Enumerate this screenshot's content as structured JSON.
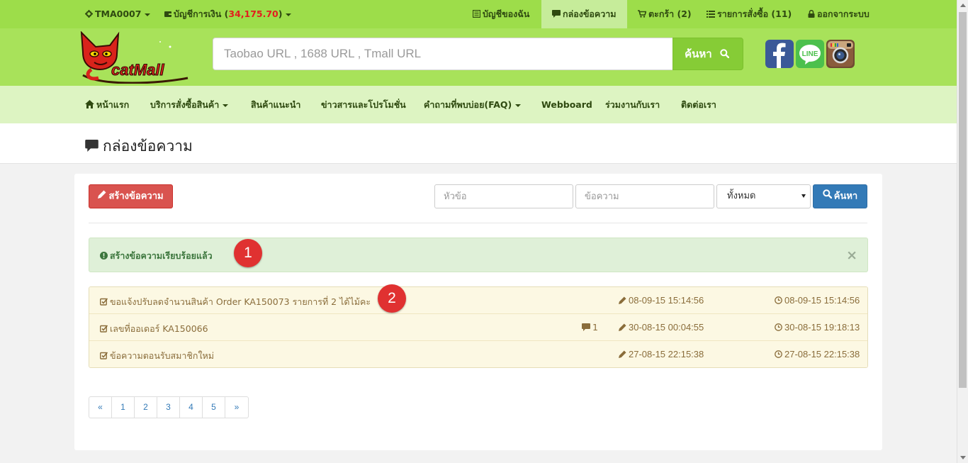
{
  "topbar": {
    "user": "TMA0007",
    "wallet_label": "บัญชีการเงิน",
    "wallet_open": " (",
    "wallet_amount": "34,175.70",
    "wallet_close": ")",
    "my_account": "บัญชีของฉัน",
    "inbox": "กล่องข้อความ",
    "cart": "ตะกร้า (2)",
    "orders": "รายการสั่งซื้อ (11)",
    "logout": "ออกจากระบบ"
  },
  "header": {
    "logo_text": "catMall",
    "search_placeholder": "Taobao URL , 1688 URL , Tmall URL",
    "search_button": "ค้นหา",
    "social": [
      "facebook-icon",
      "line-icon",
      "instagram-icon"
    ],
    "line_label": "LINE"
  },
  "nav": {
    "home": "หน้าแรก",
    "services": "บริการสั่งซื้อสินค้า",
    "recommended": "สินค้าแนะนำ",
    "news": "ข่าวสารและโปรโมชั่น",
    "faq": "คำถามที่พบบ่อย(FAQ)",
    "webboard": "Webboard",
    "partner": "ร่วมงานกับเรา",
    "contact": "ติดต่อเรา"
  },
  "page": {
    "title": "กล่องข้อความ"
  },
  "toolbar": {
    "create_button": "สร้างข้อความ",
    "subject_placeholder": "หัวข้อ",
    "message_placeholder": "ข้อความ",
    "filter_selected": "ทั้งหมด",
    "search_button": "ค้นหา"
  },
  "alert": {
    "message": "สร้างข้อความเรียบร้อยแล้ว",
    "close": "×"
  },
  "annotations": [
    "1",
    "2"
  ],
  "messages": [
    {
      "subject": "ขอแจ้งปรับลดจำนวนสินค้า Order KA150073 รายการที่ 2 ได้ไม้คะ",
      "replies": "",
      "updated": "08-09-15 15:14:56",
      "created": "08-09-15 15:14:56"
    },
    {
      "subject": "เลขที่ออเดอร์ KA150066",
      "replies": "1",
      "updated": "30-08-15 00:04:55",
      "created": "30-08-15 19:18:13"
    },
    {
      "subject": "ข้อความตอนรับสมาชิกใหม่",
      "replies": "",
      "updated": "27-08-15 22:15:38",
      "created": "27-08-15 22:15:38"
    }
  ],
  "pagination": [
    "«",
    "1",
    "2",
    "3",
    "4",
    "5",
    "»"
  ],
  "colors": {
    "topbar": "#9ddd4a",
    "header": "#a8e25a",
    "nav": "#ddf4c2",
    "create_button": "#d9534f",
    "search_button": "#337ab7",
    "alert_bg": "#dff0d8",
    "row_bg": "#fcf8e3",
    "badge": "#e03131"
  }
}
